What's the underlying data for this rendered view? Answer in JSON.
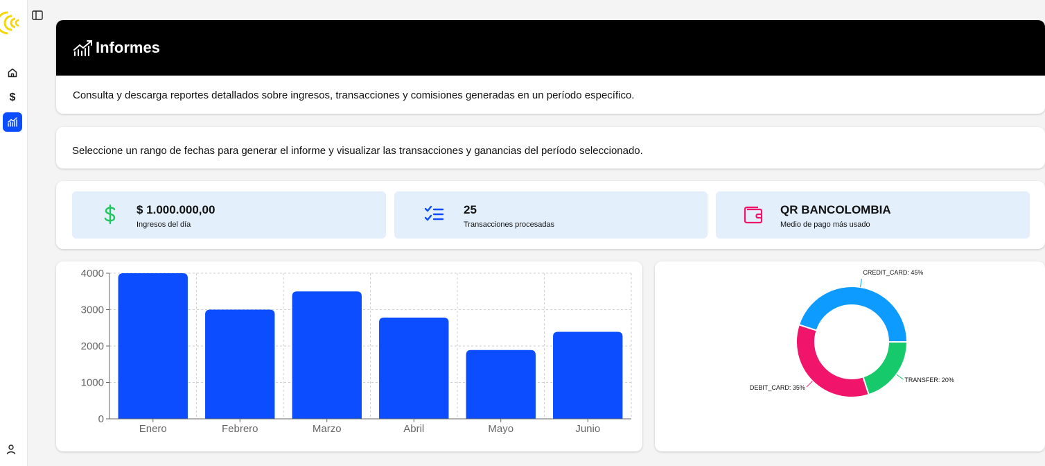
{
  "sidebar": {
    "items": [
      {
        "name": "home-icon",
        "active": false
      },
      {
        "name": "dollar-icon",
        "label": "$",
        "active": false
      },
      {
        "name": "chart-icon",
        "active": true
      }
    ]
  },
  "header": {
    "title": "Informes",
    "description": "Consulta y descarga reportes detallados sobre ingresos, transacciones y comisiones generadas en un período específico."
  },
  "range_section": {
    "text": "Seleccione un rango de fechas para generar el informe y visualizar las transacciones y ganancias del período seleccionado."
  },
  "stats": [
    {
      "icon": "dollar-icon",
      "value": "$ 1.000.000,00",
      "label": "Ingresos del día",
      "color": "#22c55e"
    },
    {
      "icon": "checklist-icon",
      "value": "25",
      "label": "Transacciones procesadas",
      "color": "#0b4dff"
    },
    {
      "icon": "wallet-icon",
      "value": "QR BANCOLOMBIA",
      "label": "Medio de pago más usado",
      "color": "#f0146a"
    }
  ],
  "chart_data": [
    {
      "type": "bar",
      "categories": [
        "Enero",
        "Febrero",
        "Marzo",
        "Abril",
        "Mayo",
        "Junio"
      ],
      "values": [
        4000,
        3000,
        3500,
        2780,
        1890,
        2390
      ],
      "ylim": [
        0,
        4000
      ],
      "yticks": [
        0,
        1000,
        2000,
        3000,
        4000
      ],
      "grid": true,
      "color": "#0b4dff"
    },
    {
      "type": "pie",
      "donut": true,
      "slices": [
        {
          "label": "CREDIT_CARD: 45%",
          "value": 45,
          "color": "#0d9bff"
        },
        {
          "label": "TRANSFER: 20%",
          "value": 20,
          "color": "#16c96a"
        },
        {
          "label": "DEBIT_CARD: 35%",
          "value": 35,
          "color": "#f0146a"
        }
      ]
    }
  ]
}
